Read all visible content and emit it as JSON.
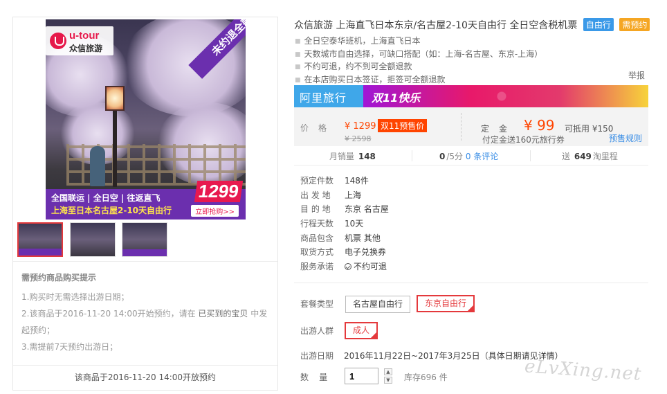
{
  "gallery": {
    "logo_en": "u-tour",
    "logo_cn": "众信旅游",
    "corner_badge": "未约退全款",
    "banner_line1": "全国联运 | 全日空 | 往返直飞",
    "banner_line2": "上海至日本名古屋2-10天自由行",
    "banner_price": "1299",
    "banner_button": "立即抢购>>"
  },
  "notice": {
    "title": "需预约商品购买提示",
    "item1": "1.购买时无需选择出游日期；",
    "item2_prefix": "2.该商品于2016-11-20 14:00开始预约，请在",
    "item2_link": "已买到的宝贝",
    "item2_suffix": "中发",
    "item2_cont": "起预约；",
    "item3": "3.需提前7天预约出游日；",
    "open_time": "该商品于2016-11-20 14:00开放预约"
  },
  "product": {
    "title": "众信旅游 上海直飞日本东京/名古屋2-10天自由行 全日空含税机票",
    "tag_free": "自由行",
    "tag_reserve": "需预约",
    "features": [
      "全日空泰华班机，上海直飞日本",
      "天数城市自由选择，可缺口搭配（如：上海-名古屋、东京-上海）",
      "不约可退，约不到可全额退款",
      "在本店购买日本签证，拒签可全额退款"
    ],
    "report": "举报"
  },
  "promo": {
    "brand": "阿里旅行",
    "double11": "双11快乐"
  },
  "price": {
    "label": "价格",
    "current": "¥ 1299",
    "badge": "双11预售价",
    "original": "¥ 2598",
    "deposit_label": "定金",
    "deposit": "¥ 99",
    "offset": "可抵用 ¥150",
    "deposit_note": "付定金送160元旅行券",
    "rules": "预售规则"
  },
  "stats": {
    "monthly_label": "月销量",
    "monthly": "148",
    "rating": "0",
    "rating_unit": "/5分",
    "reviews": "0 条评论",
    "points_prefix": "送",
    "points": "649",
    "points_suffix": "淘里程"
  },
  "attributes": [
    {
      "k": "预定件数",
      "v": "148件"
    },
    {
      "k": "出 发 地",
      "v": "上海"
    },
    {
      "k": "目 的 地",
      "v": "东京   名古屋"
    },
    {
      "k": "行程天数",
      "v": "10天"
    },
    {
      "k": "商品包含",
      "v": "机票   其他"
    },
    {
      "k": "取货方式",
      "v": "电子兑换券"
    },
    {
      "k": "服务承诺",
      "v": "不约可退"
    }
  ],
  "options": {
    "package_label": "套餐类型",
    "package_1": "名古屋自由行",
    "package_2": "东京自由行",
    "traveler_label": "出游人群",
    "traveler_1": "成人",
    "date_label": "出游日期",
    "date_value": "2016年11月22日~2017年3月25日（具体日期请见详情）",
    "qty_label": "数    量",
    "qty_value": "1",
    "stock": "库存696 件"
  },
  "watermark": "eLvXing.net"
}
